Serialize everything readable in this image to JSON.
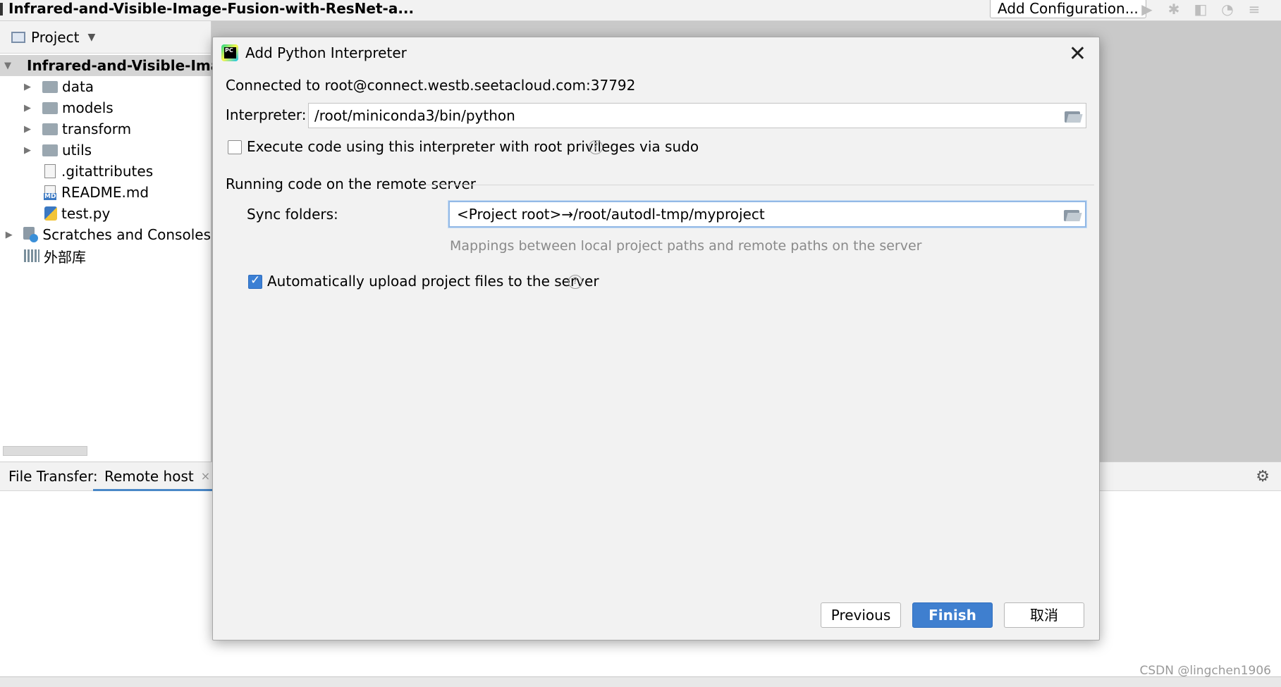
{
  "titlebar": {
    "project_title": "Infrared-and-Visible-Image-Fusion-with-ResNet-a...",
    "add_configuration": "Add Configuration..."
  },
  "project_panel": {
    "header": "Project",
    "tree": [
      {
        "label": "Infrared-and-Visible-Image",
        "kind": "root-folder",
        "expanded": true
      },
      {
        "label": "data",
        "kind": "folder"
      },
      {
        "label": "models",
        "kind": "folder"
      },
      {
        "label": "transform",
        "kind": "folder"
      },
      {
        "label": "utils",
        "kind": "folder"
      },
      {
        "label": ".gitattributes",
        "kind": "file"
      },
      {
        "label": "README.md",
        "kind": "markdown"
      },
      {
        "label": "test.py",
        "kind": "python"
      },
      {
        "label": "Scratches and Consoles",
        "kind": "scratches"
      },
      {
        "label": "外部库",
        "kind": "libraries"
      }
    ]
  },
  "bottom": {
    "file_transfer_label": "File Transfer:",
    "remote_host_tab": "Remote host",
    "close_glyph": "×"
  },
  "dialog": {
    "title": "Add Python Interpreter",
    "connected": "Connected to root@connect.westb.seetacloud.com:37792",
    "interpreter_label": "Interpreter:",
    "interpreter_value": "/root/miniconda3/bin/python",
    "sudo_label": "Execute code using this interpreter with root privileges via sudo",
    "sudo_checked": false,
    "section_title": "Running code on the remote server",
    "sync_label": "Sync folders:",
    "sync_value": "<Project root>→/root/autodl-tmp/myproject",
    "sync_hint": "Mappings between local project paths and remote paths on the server",
    "upload_label": "Automatically upload project files to the server",
    "upload_checked": true,
    "help_glyph": "?",
    "buttons": {
      "previous": "Previous",
      "finish": "Finish",
      "cancel": "取消"
    }
  },
  "watermark": "CSDN @lingchen1906",
  "colors": {
    "accent": "#3f7fcf",
    "focus_border": "#93b9e6",
    "overlay_gray": "#c9c9c9"
  }
}
